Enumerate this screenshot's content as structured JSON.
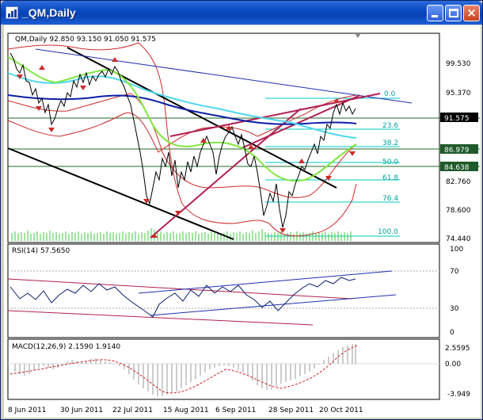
{
  "window": {
    "title": "_QM,Daily",
    "minimize_label": "",
    "maximize_label": "",
    "close_label": "×"
  },
  "main_panel": {
    "header": "QM,Daily  92.850 93.150 91.050 91.575",
    "price_ticks": [
      "99.530",
      "95.370",
      "82.760",
      "78.600",
      "74.440"
    ],
    "highlight_labels": [
      {
        "text": "91.575",
        "bg": "#000000"
      },
      {
        "text": "86.979",
        "bg": "#1f5a2a"
      },
      {
        "text": "84.638",
        "bg": "#1f5a2a"
      }
    ],
    "fib_levels": [
      "0.0",
      "23.6",
      "38.2",
      "50.0",
      "61.8",
      "76.4",
      "100.0"
    ]
  },
  "rsi_panel": {
    "header": "RSI(14) 57.5650",
    "ticks": [
      "100",
      "70",
      "30",
      "0"
    ]
  },
  "macd_panel": {
    "header": "MACD(12,26,9) 2.1590 1.9140",
    "ticks": [
      "2.5595",
      "0.00",
      "-3.949"
    ]
  },
  "time_axis": [
    "8 Jun 2011",
    "30 Jun 2011",
    "22 Jul 2011",
    "15 Aug 2011",
    "6 Sep 2011",
    "28 Sep 2011",
    "20 Oct 2011"
  ],
  "colors": {
    "grid_green": "#1f6b2a",
    "bands": "#cc2a2a",
    "channel": "#c02040",
    "fib": "#00c8c8",
    "ma_blue": "#0d1fa8",
    "ma_cyan": "#4fd7ee",
    "ma_green": "#80e840",
    "volume": "#3cc83c"
  }
}
